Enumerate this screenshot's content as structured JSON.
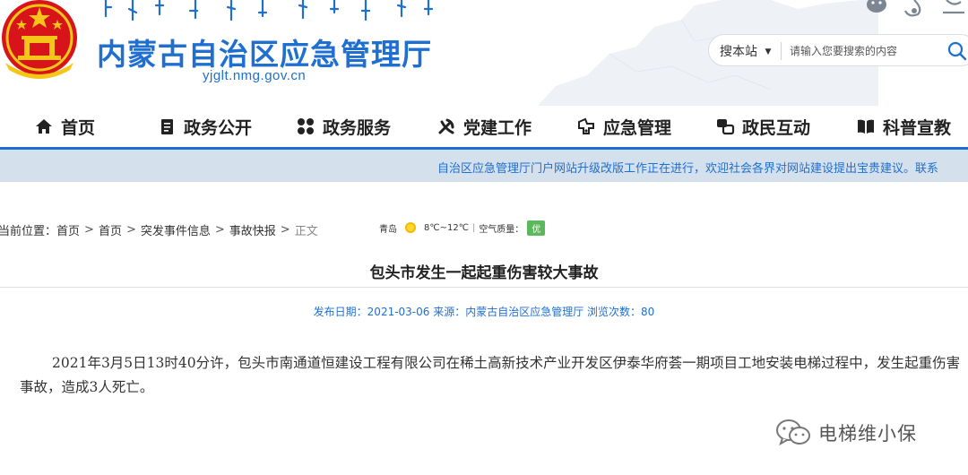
{
  "header": {
    "site_title": "内蒙古自治区应急管理厅",
    "site_domain": "yjglt.nmg.gov.cn",
    "search": {
      "scope_label": "搜本站",
      "placeholder": "请输入您要搜索的内容"
    }
  },
  "nav": {
    "items": [
      {
        "label": "首页",
        "icon": "home-icon"
      },
      {
        "label": "政务公开",
        "icon": "document-icon"
      },
      {
        "label": "政务服务",
        "icon": "services-icon"
      },
      {
        "label": "党建工作",
        "icon": "party-icon"
      },
      {
        "label": "应急管理",
        "icon": "emergency-icon"
      },
      {
        "label": "政民互动",
        "icon": "interaction-icon"
      },
      {
        "label": "科普宣教",
        "icon": "book-icon"
      }
    ]
  },
  "notice": "自治区应急管理厅门户网站升级改版工作正在进行，欢迎社会各界对网站建设提出宝贵建议。联系",
  "breadcrumb": {
    "prefix": "当前位置：",
    "items": [
      "首页",
      "首页",
      "突发事件信息",
      "事故快报"
    ],
    "current": "正文",
    "separator": ">"
  },
  "weather": {
    "city": "青岛",
    "temp": "8℃~12℃",
    "divider": "|",
    "air_label": "空气质量：",
    "air_value": "优"
  },
  "article": {
    "title": "包头市发生一起起重伤害较大事故",
    "meta": "发布日期：2021-03-06 来源：内蒙古自治区应急管理厅 浏览次数：80",
    "body": "2021年3月5日13时40分许，包头市南通道恒建设工程有限公司在稀土高新技术产业开发区伊泰华府荟一期项目工地安装电梯过程中，发生起重伤害事故，造成3人死亡。"
  },
  "watermark": "电梯维小保",
  "colors": {
    "brand_blue": "#1f6fd0",
    "notice_bg": "#d4e0ec",
    "emblem_red": "#d7141a",
    "emblem_gold": "#f5c518",
    "aqi_green": "#5cb85c"
  }
}
